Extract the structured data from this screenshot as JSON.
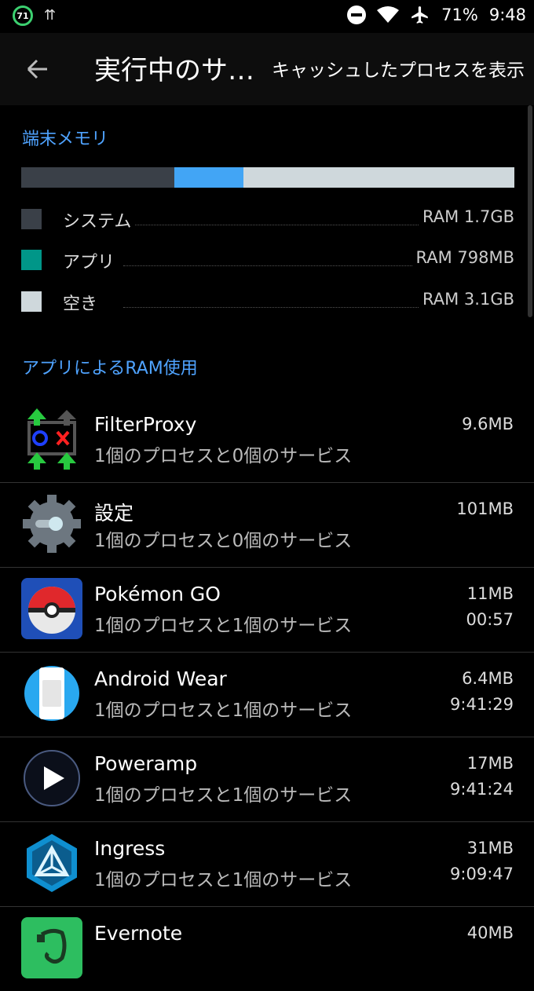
{
  "status_bar": {
    "battery_level": "71",
    "battery_percent": "71%",
    "time": "9:48",
    "icons": [
      "battery-circle-icon",
      "usb-icon",
      "do-not-disturb-icon",
      "wifi-icon",
      "airplane-icon"
    ]
  },
  "app_bar": {
    "title": "実行中のサ…",
    "action": "キャッシュしたプロセスを表示"
  },
  "device_memory": {
    "heading": "端末メモリ",
    "bar": {
      "system_fraction": 0.31,
      "apps_fraction": 0.14,
      "free_fraction": 0.55
    },
    "colors": {
      "system": "#3a4048",
      "apps_bar": "#42a5f5",
      "apps_swatch": "#009688",
      "free": "#cfd8dc"
    },
    "legend": [
      {
        "label": "システム",
        "value": "RAM 1.7GB"
      },
      {
        "label": "アプリ",
        "value": "RAM 798MB"
      },
      {
        "label": "空き",
        "value": "RAM 3.1GB"
      }
    ]
  },
  "app_ram": {
    "heading": "アプリによるRAM使用",
    "apps": [
      {
        "name": "FilterProxy",
        "detail": "1個のプロセスと0個のサービス",
        "size": "9.6MB",
        "time": "",
        "icon": "filterproxy-icon"
      },
      {
        "name": "設定",
        "detail": "1個のプロセスと0個のサービス",
        "size": "101MB",
        "time": "",
        "icon": "settings-gear-icon"
      },
      {
        "name": "Pokémon GO",
        "detail": "1個のプロセスと1個のサービス",
        "size": "11MB",
        "time": "00:57",
        "icon": "pokeball-icon"
      },
      {
        "name": "Android Wear",
        "detail": "1個のプロセスと1個のサービス",
        "size": "6.4MB",
        "time": "9:41:29",
        "icon": "android-wear-icon"
      },
      {
        "name": "Poweramp",
        "detail": "1個のプロセスと1個のサービス",
        "size": "17MB",
        "time": "9:41:24",
        "icon": "poweramp-play-icon"
      },
      {
        "name": "Ingress",
        "detail": "1個のプロセスと1個のサービス",
        "size": "31MB",
        "time": "9:09:47",
        "icon": "ingress-icon"
      },
      {
        "name": "Evernote",
        "detail": "",
        "size": "40MB",
        "time": "",
        "icon": "evernote-icon"
      }
    ]
  }
}
